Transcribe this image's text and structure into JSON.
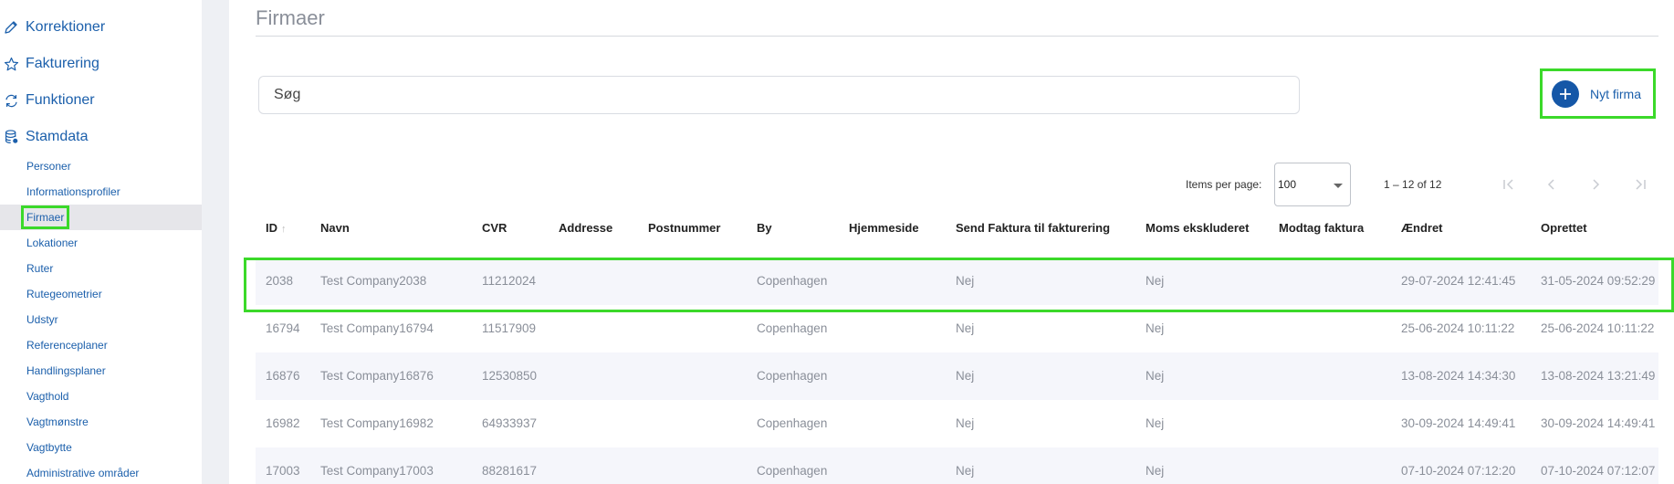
{
  "sidebar": {
    "top_items": [
      {
        "label": "Korrektioner",
        "icon": "pencil-icon"
      },
      {
        "label": "Fakturering",
        "icon": "star-icon"
      },
      {
        "label": "Funktioner",
        "icon": "refresh-icon"
      },
      {
        "label": "Stamdata",
        "icon": "database-icon"
      }
    ],
    "sub_items": [
      {
        "label": "Personer"
      },
      {
        "label": "Informationsprofiler"
      },
      {
        "label": "Firmaer",
        "active": true
      },
      {
        "label": "Lokationer"
      },
      {
        "label": "Ruter"
      },
      {
        "label": "Rutegeometrier"
      },
      {
        "label": "Udstyr"
      },
      {
        "label": "Referenceplaner"
      },
      {
        "label": "Handlingsplaner"
      },
      {
        "label": "Vagthold"
      },
      {
        "label": "Vagtmønstre"
      },
      {
        "label": "Vagtbytte"
      },
      {
        "label": "Administrative områder"
      }
    ]
  },
  "main": {
    "title": "Firmaer",
    "search_placeholder": "Søg",
    "new_button_label": "Nyt firma"
  },
  "paginator": {
    "items_per_page_label": "Items per page:",
    "items_per_page_value": "100",
    "range_label": "1 – 12 of 12"
  },
  "table": {
    "columns": [
      "ID",
      "Navn",
      "CVR",
      "Addresse",
      "Postnummer",
      "By",
      "Hjemmeside",
      "Send Faktura til fakturering",
      "Moms ekskluderet",
      "Modtag faktura",
      "Ændret",
      "Oprettet"
    ],
    "rows": [
      [
        "2038",
        "Test Company2038",
        "11212024",
        "",
        "",
        "Copenhagen",
        "",
        "Nej",
        "Nej",
        "",
        "29-07-2024 12:41:45",
        "31-05-2024 09:52:29"
      ],
      [
        "16794",
        "Test Company16794",
        "11517909",
        "",
        "",
        "Copenhagen",
        "",
        "Nej",
        "Nej",
        "",
        "25-06-2024 10:11:22",
        "25-06-2024 10:11:22"
      ],
      [
        "16876",
        "Test Company16876",
        "12530850",
        "",
        "",
        "Copenhagen",
        "",
        "Nej",
        "Nej",
        "",
        "13-08-2024 14:34:30",
        "13-08-2024 13:21:49"
      ],
      [
        "16982",
        "Test Company16982",
        "64933937",
        "",
        "",
        "Copenhagen",
        "",
        "Nej",
        "Nej",
        "",
        "30-09-2024 14:49:41",
        "30-09-2024 14:49:41"
      ],
      [
        "17003",
        "Test Company17003",
        "88281617",
        "",
        "",
        "Copenhagen",
        "",
        "Nej",
        "Nej",
        "",
        "07-10-2024 07:12:20",
        "07-10-2024 07:12:07"
      ]
    ]
  },
  "colors": {
    "link": "#1b5fab",
    "accent": "#1557a7",
    "highlight": "#3bd92a",
    "muted_text": "#8a8f99"
  }
}
